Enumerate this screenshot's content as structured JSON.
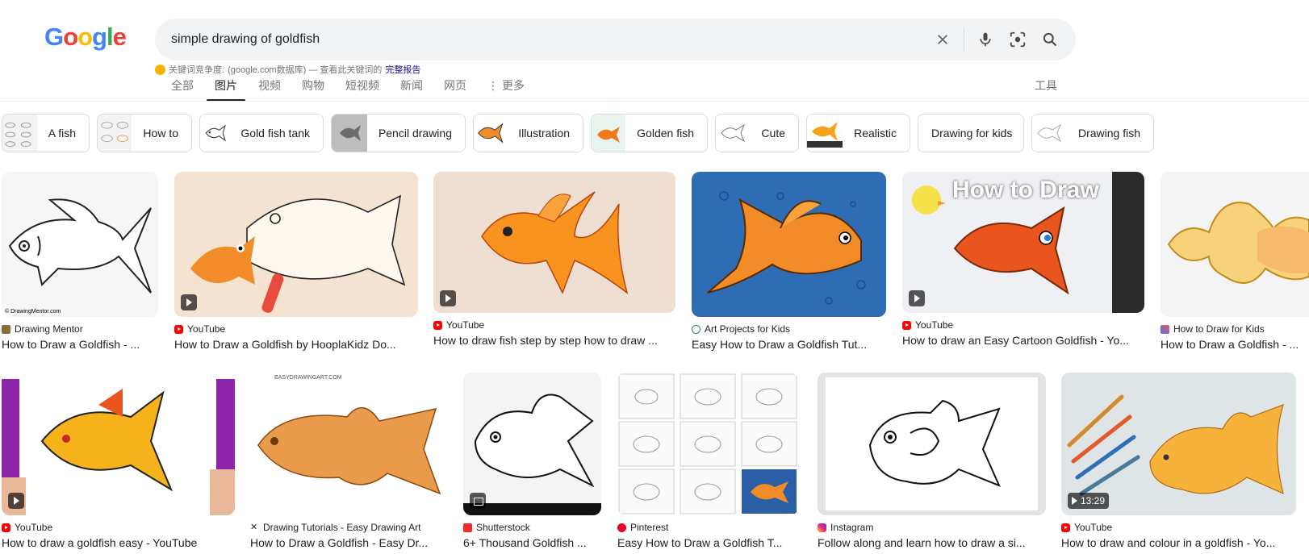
{
  "search": {
    "query": "simple drawing of goldfish"
  },
  "seo": {
    "label": "关键词竞争度:",
    "source": "(google.com数据库) — 查看此关键词的",
    "report_link": "完整报告"
  },
  "tabs": [
    {
      "label": "全部"
    },
    {
      "label": "图片"
    },
    {
      "label": "视频"
    },
    {
      "label": "购物"
    },
    {
      "label": "短视频"
    },
    {
      "label": "新闻"
    },
    {
      "label": "网页"
    },
    {
      "label": "更多"
    }
  ],
  "tools_label": "工具",
  "chips": [
    {
      "label": "A fish"
    },
    {
      "label": "How to"
    },
    {
      "label": "Gold fish tank"
    },
    {
      "label": "Pencil drawing"
    },
    {
      "label": "Illustration"
    },
    {
      "label": "Golden fish"
    },
    {
      "label": "Cute"
    },
    {
      "label": "Realistic"
    },
    {
      "label": "Drawing for kids"
    },
    {
      "label": "Drawing fish"
    }
  ],
  "results": [
    {
      "source": "Drawing Mentor",
      "title": "How to Draw a Goldfish - ...",
      "watermark": "© DrawingMentor.com"
    },
    {
      "source": "YouTube",
      "title": "How to Draw a Goldfish by HooplaKidz Do..."
    },
    {
      "source": "YouTube",
      "title": "How to draw fish step by step how to draw ..."
    },
    {
      "source": "Art Projects for Kids",
      "title": "Easy How to Draw a Goldfish Tut..."
    },
    {
      "source": "YouTube",
      "title": "How to draw an Easy Cartoon Goldfish - Yo...",
      "overlay": "How to Draw"
    },
    {
      "source": "How to Draw for Kids",
      "title": "How to Draw a Goldfish - ..."
    },
    {
      "source": "YouTube",
      "title": "How to draw a goldfish easy - YouTube"
    },
    {
      "source": "Drawing Tutorials - Easy Drawing Art",
      "title": "How to Draw a Goldfish - Easy Dr...",
      "watermark": "EASYDRAWINGART.COM"
    },
    {
      "source": "Shutterstock",
      "title": "6+ Thousand Goldfish ..."
    },
    {
      "source": "Pinterest",
      "title": "Easy How to Draw a Goldfish T..."
    },
    {
      "source": "Instagram",
      "title": "Follow along and learn how to draw a si..."
    },
    {
      "source": "YouTube",
      "title": "How to draw and colour in a goldfish - Yo...",
      "duration": "13:29"
    }
  ],
  "colors": {
    "accent": "#1a73e8",
    "link": "#1a0dab",
    "goldfish": "#f28c28"
  }
}
